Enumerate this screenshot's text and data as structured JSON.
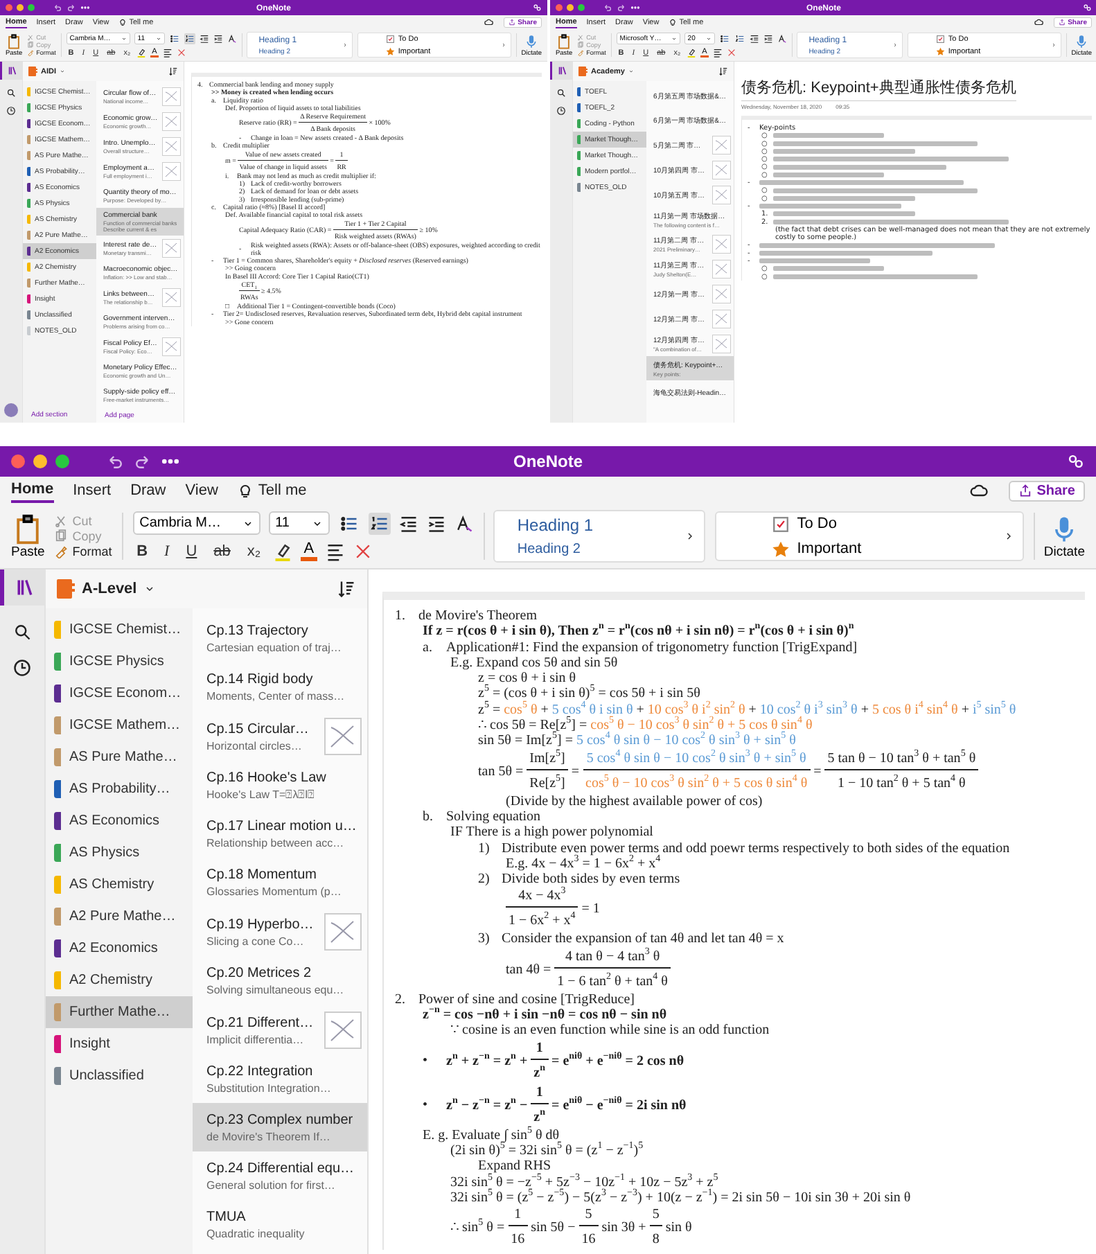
{
  "screenshots_top": [
    {
      "title": "OneNote",
      "menu_tabs": [
        {
          "label": "Home",
          "selected": true
        },
        {
          "label": "Insert",
          "selected": false
        },
        {
          "label": "Draw",
          "selected": false
        },
        {
          "label": "View",
          "selected": false
        },
        {
          "label": "Tell me",
          "selected": false
        }
      ],
      "share": "Share",
      "paste": "Paste",
      "clipboard": [
        {
          "label": "Cut",
          "disabled": true
        },
        {
          "label": "Copy",
          "disabled": true
        },
        {
          "label": "Format",
          "disabled": false
        }
      ],
      "font": "Cambria M…",
      "font_size": "11",
      "numbering_on": true,
      "format_buttons": [
        "B",
        "I",
        "U",
        "ab",
        "x₂"
      ],
      "font_color": "A",
      "styles": [
        "Heading 1",
        "Heading 2"
      ],
      "tags": [
        {
          "label": "To Do",
          "kind": "todo"
        },
        {
          "label": "Important",
          "kind": "important"
        }
      ],
      "dictate": "Dictate",
      "notebook": "AIDI",
      "sections": [
        {
          "name": "IGCSE Chemist…",
          "color": "#f5b800",
          "selected": false
        },
        {
          "name": "IGCSE Physics",
          "color": "#3aa757",
          "selected": false
        },
        {
          "name": "IGCSE Econom…",
          "color": "#5c2d91",
          "selected": false
        },
        {
          "name": "IGCSE Mathem…",
          "color": "#c19a6b",
          "selected": false
        },
        {
          "name": "AS Pure Mathe…",
          "color": "#c19a6b",
          "selected": false
        },
        {
          "name": "AS Probability…",
          "color": "#1f5fb4",
          "selected": false
        },
        {
          "name": "AS Economics",
          "color": "#5c2d91",
          "selected": false
        },
        {
          "name": "AS Physics",
          "color": "#3aa757",
          "selected": false
        },
        {
          "name": "AS Chemistry",
          "color": "#f5b800",
          "selected": false
        },
        {
          "name": "A2 Pure Mathe…",
          "color": "#c19a6b",
          "selected": false
        },
        {
          "name": "A2 Economics",
          "color": "#5c2d91",
          "selected": true
        },
        {
          "name": "A2 Chemistry",
          "color": "#f5b800",
          "selected": false
        },
        {
          "name": "Further Mathe…",
          "color": "#c19a6b",
          "selected": false
        },
        {
          "name": "Insight",
          "color": "#d6137a",
          "selected": false
        },
        {
          "name": "Unclassified",
          "color": "#7a8691",
          "selected": false
        },
        {
          "name": "NOTES_OLD",
          "color": "#c8ccd0",
          "selected": false
        }
      ],
      "pages": [
        {
          "title": "Circular flow of…",
          "preview": "National income…",
          "thumbnail": true,
          "selected": false
        },
        {
          "title": "Economic grow…",
          "preview": "Economic growth…",
          "thumbnail": true,
          "selected": false
        },
        {
          "title": "Intro. Unemplo…",
          "preview": "Overall structure…",
          "thumbnail": true,
          "selected": false
        },
        {
          "title": "Employment a…",
          "preview": "Full employment i…",
          "thumbnail": true,
          "selected": false
        },
        {
          "title": "Quantity theory of mo…",
          "preview": "Purpose: Developed by…",
          "thumbnail": false,
          "selected": false
        },
        {
          "title": "Commercial bank",
          "preview": "Function of commercial banks  Describe current & es",
          "thumbnail": false,
          "selected": true
        },
        {
          "title": "Interest rate de…",
          "preview": "Monetary transmi…",
          "thumbnail": true,
          "selected": false
        },
        {
          "title": "Macroeconomic objec…",
          "preview": "Inflation: >> Low and stab…",
          "thumbnail": false,
          "selected": false
        },
        {
          "title": "Links between…",
          "preview": "The relationship b…",
          "thumbnail": true,
          "selected": false
        },
        {
          "title": "Government interven…",
          "preview": "Problems arising from co…",
          "thumbnail": false,
          "selected": false
        },
        {
          "title": "Fiscal Policy Ef…",
          "preview": "Fiscal Policy: Eco…",
          "thumbnail": true,
          "selected": false
        },
        {
          "title": "Monetary Policy Effec…",
          "preview": "Economic growth and Un…",
          "thumbnail": false,
          "selected": false
        },
        {
          "title": "Supply-side policy eff…",
          "preview": "Free-market instruments…",
          "thumbnail": false,
          "selected": false
        }
      ],
      "add_section": "Add section",
      "add_page": "Add page",
      "note": [
        {
          "marker": "4.",
          "text": "Commercial bank lending and money supply",
          "children": [
            {
              "text": ">> Money is created when lending occurs",
              "bold": true
            },
            {
              "marker": "a.",
              "text": "Liquidity ratio",
              "children": [
                {
                  "text": "Def. Proportion of liquid assets to total liabilities",
                  "children": [
                    {
                      "parts": [
                        {
                          "t": "Reserve ratio (RR) = "
                        },
                        {
                          "num": [
                            {
                              "t": "Δ Reserve Requirement"
                            }
                          ],
                          "den": [
                            {
                              "t": "Δ Bank deposits"
                            }
                          ]
                        },
                        {
                          "t": " × 100%"
                        }
                      ]
                    },
                    {
                      "marker": "-",
                      "text": "Change in loan = New assets created - Δ Bank deposits"
                    }
                  ]
                }
              ]
            },
            {
              "marker": "b.",
              "text": "Credit multiplier",
              "children": [
                {
                  "parts": [
                    {
                      "t": "m = "
                    },
                    {
                      "num": [
                        {
                          "t": "Value of new assets created"
                        }
                      ],
                      "den": [
                        {
                          "t": "Value of change in liquid assets"
                        }
                      ]
                    },
                    {
                      "t": " = "
                    },
                    {
                      "num": [
                        {
                          "t": "1"
                        }
                      ],
                      "den": [
                        {
                          "t": "RR"
                        }
                      ]
                    }
                  ]
                },
                {
                  "marker": "i.",
                  "text": "Bank may not lend as much as credit multiplier if:",
                  "children": [
                    {
                      "marker": "1)",
                      "text": "Lack of credit-worthy borrowers"
                    },
                    {
                      "marker": "2)",
                      "text": "Lack of demand for loan or debt assets"
                    },
                    {
                      "marker": "3)",
                      "text": "Irresponsible lending (sub-prime)"
                    }
                  ]
                }
              ]
            },
            {
              "marker": "c.",
              "text": "Capital ratio (≈8%) [Basel II accord]",
              "children": [
                {
                  "text": "Def. Available financial capital to total risk assets",
                  "children": [
                    {
                      "parts": [
                        {
                          "t": "Capital Adequacy Ratio (CAR) = "
                        },
                        {
                          "num": [
                            {
                              "t": "Tier 1 + Tier 2 Capital"
                            }
                          ],
                          "den": [
                            {
                              "t": "Risk weighted assets (RWAs)"
                            }
                          ]
                        },
                        {
                          "t": " ≥ 10%"
                        }
                      ]
                    },
                    {
                      "marker": "-",
                      "text": "Risk weighted assets (RWA): Assets or off-balance-sheet (OBS) exposures, weighted according to credit risk"
                    }
                  ]
                }
              ]
            },
            {
              "marker": "-",
              "text": "Tier 1 = Common shares, Shareholder's equity + *Disclosed reserves* (Reserved earnings)",
              "children": [
                {
                  "text": ">> Going concern"
                },
                {
                  "text": "In Basel III Accord: Core Tier 1 Capital Ratio(CT1)",
                  "children": [
                    {
                      "parts": [
                        {
                          "num": [
                            {
                              "t": "CET$_{1}$"
                            }
                          ],
                          "den": [
                            {
                              "t": "RWAs"
                            }
                          ]
                        },
                        {
                          "t": " ≥ 4.5%"
                        }
                      ]
                    }
                  ]
                },
                {
                  "marker": "□",
                  "text": "Additional Tier 1 = Contingent-convertible bonds (Coco)"
                }
              ]
            },
            {
              "marker": "-",
              "text": "Tier 2= Undisclosed reserves, Revaluation reserves, Subordinated term debt, Hybrid debt capital instrument",
              "children": [
                {
                  "text": ">> Gone concern"
                }
              ]
            }
          ]
        }
      ]
    },
    {
      "title": "OneNote",
      "menu_tabs": [
        {
          "label": "Home",
          "selected": true
        },
        {
          "label": "Insert",
          "selected": false
        },
        {
          "label": "Draw",
          "selected": false
        },
        {
          "label": "View",
          "selected": false
        },
        {
          "label": "Tell me",
          "selected": false
        }
      ],
      "share": "Share",
      "paste": "Paste",
      "clipboard": [
        {
          "label": "Cut",
          "disabled": true
        },
        {
          "label": "Copy",
          "disabled": true
        },
        {
          "label": "Format",
          "disabled": false
        }
      ],
      "font": "Microsoft Y…",
      "font_size": "20",
      "numbering_on": false,
      "format_buttons": [
        "B",
        "I",
        "U",
        "ab",
        "x₂"
      ],
      "font_color": "A",
      "styles": [
        "Heading 1",
        "Heading 2"
      ],
      "tags": [
        {
          "label": "To Do",
          "kind": "todo"
        },
        {
          "label": "Important",
          "kind": "important"
        }
      ],
      "dictate": "Dictate",
      "notebook": "Academy",
      "sections": [
        {
          "name": "TOEFL",
          "color": "#1f5fb4",
          "selected": false
        },
        {
          "name": "TOEFL_2",
          "color": "#1f5fb4",
          "selected": false
        },
        {
          "name": "Coding - Python",
          "color": "#3aa757",
          "selected": false
        },
        {
          "name": "Market Though…",
          "color": "#3aa757",
          "selected": true
        },
        {
          "name": "Market Though…",
          "color": "#3aa757",
          "selected": false
        },
        {
          "name": "Modern portfol…",
          "color": "#3aa757",
          "selected": false
        },
        {
          "name": "NOTES_OLD",
          "color": "#7a8691",
          "selected": false
        }
      ],
      "pages": [
        {
          "title": "6月第五周 市场数据&…",
          "thumbnail": false,
          "selected": false
        },
        {
          "title": "6月第一周 市场数据&…",
          "thumbnail": false,
          "selected": false
        },
        {
          "title": "5月第二周 市…",
          "thumbnail": true,
          "selected": false
        },
        {
          "title": "10月第四周 市…",
          "thumbnail": true,
          "selected": false
        },
        {
          "title": "10月第五周 市…",
          "thumbnail": true,
          "selected": false
        },
        {
          "title": "11月第一周 市场数据…",
          "preview": "The following content is f…",
          "thumbnail": false,
          "selected": false
        },
        {
          "title": "11月第二周 市…",
          "preview": "2021 Preliminary…",
          "thumbnail": true,
          "selected": false
        },
        {
          "title": "11月第三周 市…",
          "preview": "Judy Shelton(E…",
          "thumbnail": true,
          "selected": false
        },
        {
          "title": "12月第一周 市…",
          "thumbnail": true,
          "selected": false
        },
        {
          "title": "12月第二周 市…",
          "thumbnail": true,
          "selected": false
        },
        {
          "title": "12月第四周 市…",
          "preview": "\"A combination of…",
          "thumbnail": true,
          "selected": false
        },
        {
          "title": "债务危机: Keypoint+…",
          "preview": "Key points:",
          "thumbnail": false,
          "selected": true
        },
        {
          "title": "海龟交易法则-Headin…",
          "thumbnail": false,
          "selected": false
        }
      ],
      "page_heading": "债务危机: Keypoint+典型通胀性债务危机",
      "page_date": "Wednesday, November 18, 2020",
      "page_time": "09:35",
      "note": [
        {
          "marker": "-",
          "text": "Key-points",
          "children": [
            {
              "marker": "○",
              "kind": "blurred"
            },
            {
              "marker": "○",
              "kind": "blurred"
            },
            {
              "marker": "○",
              "kind": "blurred"
            },
            {
              "marker": "○",
              "kind": "blurred"
            },
            {
              "marker": "○",
              "kind": "blurred"
            },
            {
              "marker": "○",
              "kind": "blurred"
            }
          ]
        },
        {
          "marker": "-",
          "kind": "blurred",
          "children": [
            {
              "marker": "○",
              "kind": "blurred"
            },
            {
              "marker": "○",
              "kind": "blurred"
            }
          ]
        },
        {
          "marker": "-",
          "kind": "blurred",
          "children": [
            {
              "marker": "1.",
              "kind": "blurred"
            },
            {
              "marker": "2.",
              "kind": "blurred",
              "children": [
                {
                  "text": "(the fact that debt crises can be well-managed does not mean that they are not extremely costly to some people.)"
                }
              ]
            }
          ]
        },
        {
          "marker": "-",
          "kind": "blurred"
        },
        {
          "marker": "-",
          "kind": "blurred"
        },
        {
          "marker": "-",
          "kind": "blurred",
          "children": [
            {
              "marker": "○",
              "kind": "blurred"
            },
            {
              "marker": "○",
              "kind": "blurred"
            }
          ]
        }
      ]
    }
  ],
  "main_window": {
    "title": "OneNote",
    "menu_tabs": [
      {
        "label": "Home",
        "selected": true
      },
      {
        "label": "Insert",
        "selected": false
      },
      {
        "label": "Draw",
        "selected": false
      },
      {
        "label": "View",
        "selected": false
      },
      {
        "label": "Tell me",
        "selected": false
      }
    ],
    "share": "Share",
    "paste": "Paste",
    "clipboard": [
      {
        "label": "Cut",
        "disabled": true
      },
      {
        "label": "Copy",
        "disabled": true
      },
      {
        "label": "Format",
        "disabled": false
      }
    ],
    "font": "Cambria M…",
    "font_size": "11",
    "numbering_on": true,
    "format_buttons": [
      "B",
      "I",
      "U",
      "ab",
      "x₂"
    ],
    "font_color": "A",
    "styles": [
      "Heading 1",
      "Heading 2"
    ],
    "tags": [
      {
        "label": "To Do",
        "kind": "todo"
      },
      {
        "label": "Important",
        "kind": "important"
      }
    ],
    "dictate": "Dictate",
    "notebook": "A-Level",
    "sections": [
      {
        "name": "IGCSE Chemist…",
        "color": "#f5b800",
        "selected": false
      },
      {
        "name": "IGCSE Physics",
        "color": "#3aa757",
        "selected": false
      },
      {
        "name": "IGCSE Econom…",
        "color": "#5c2d91",
        "selected": false
      },
      {
        "name": "IGCSE Mathem…",
        "color": "#c19a6b",
        "selected": false
      },
      {
        "name": "AS Pure Mathe…",
        "color": "#c19a6b",
        "selected": false
      },
      {
        "name": "AS Probability…",
        "color": "#1f5fb4",
        "selected": false
      },
      {
        "name": "AS Economics",
        "color": "#5c2d91",
        "selected": false
      },
      {
        "name": "AS Physics",
        "color": "#3aa757",
        "selected": false
      },
      {
        "name": "AS Chemistry",
        "color": "#f5b800",
        "selected": false
      },
      {
        "name": "A2 Pure Mathe…",
        "color": "#c19a6b",
        "selected": false
      },
      {
        "name": "A2 Economics",
        "color": "#5c2d91",
        "selected": false
      },
      {
        "name": "A2 Chemistry",
        "color": "#f5b800",
        "selected": false
      },
      {
        "name": "Further Mathe…",
        "color": "#c19a6b",
        "selected": true
      },
      {
        "name": "Insight",
        "color": "#d6137a",
        "selected": false
      },
      {
        "name": "Unclassified",
        "color": "#7a8691",
        "selected": false
      }
    ],
    "pages": [
      {
        "title": "Cp.13 Trajectory",
        "preview": "Cartesian equation of traj…",
        "thumbnail": false,
        "selected": false
      },
      {
        "title": "Cp.14 Rigid body",
        "preview": "Moments, Center of mass…",
        "thumbnail": false,
        "selected": false
      },
      {
        "title": "Cp.15 Circular…",
        "preview": "Horizontal circles…",
        "thumbnail": true,
        "selected": false
      },
      {
        "title": "Cp.16 Hooke's Law",
        "preview": "Hooke's Law  T=⍰λ⍰l⍰",
        "thumbnail": false,
        "selected": false
      },
      {
        "title": "Cp.17 Linear motion u…",
        "preview": "Relationship between acc…",
        "thumbnail": false,
        "selected": false
      },
      {
        "title": "Cp.18 Momentum",
        "preview": "Glossaries  Momentum (p…",
        "thumbnail": false,
        "selected": false
      },
      {
        "title": "Cp.19 Hyperbo…",
        "preview": "Slicing a cone  Co…",
        "thumbnail": true,
        "selected": false
      },
      {
        "title": "Cp.20 Metrices 2",
        "preview": "Solving simultaneous equ…",
        "thumbnail": false,
        "selected": false
      },
      {
        "title": "Cp.21 Different…",
        "preview": "Implicit differentia…",
        "thumbnail": true,
        "selected": false
      },
      {
        "title": "Cp.22 Integration",
        "preview": "Substitution  Integration…",
        "thumbnail": false,
        "selected": false
      },
      {
        "title": "Cp.23 Complex number",
        "preview": "de Movire's Theorem  If…",
        "thumbnail": false,
        "selected": true
      },
      {
        "title": "Cp.24 Differential equ…",
        "preview": "General solution for first…",
        "thumbnail": false,
        "selected": false
      },
      {
        "title": "TMUA",
        "preview": "Quadratic inequality",
        "thumbnail": false,
        "selected": false
      }
    ],
    "note": [
      {
        "marker": "1.",
        "text": "de Movire's Theorem",
        "children": [
          {
            "bold": true,
            "parts": [
              {
                "t": "If z = r(cos θ + i sin θ), Then z$^{n}$ = r$^{n}$(cos nθ + i sin nθ) = r$^{n}$(cos θ + i sin θ)$^{n}$"
              }
            ]
          },
          {
            "marker": "a.",
            "text": "Application#1: Find the expansion of trigonometry function [TrigExpand]",
            "children": [
              {
                "text": "E.g. Expand cos 5θ and sin 5θ",
                "children": [
                  {
                    "parts": [
                      {
                        "t": "z = cos θ + i sin θ"
                      }
                    ]
                  },
                  {
                    "parts": [
                      {
                        "t": "z$^{5}$ = (cos θ + i sin θ)$^{5}$ = cos 5θ + i sin 5θ"
                      }
                    ]
                  },
                  {
                    "parts": [
                      {
                        "t": "z$^{5}$ = "
                      },
                      {
                        "t": "cos$^{5}$ θ",
                        "color": "#ee8a3c"
                      },
                      {
                        "t": " + "
                      },
                      {
                        "t": "5 cos$^{4}$ θ i sin θ",
                        "color": "#5b9bd5"
                      },
                      {
                        "t": " + "
                      },
                      {
                        "t": "10 cos$^{3}$ θ i$^{2}$ sin$^{2}$ θ",
                        "color": "#ee8a3c"
                      },
                      {
                        "t": " + "
                      },
                      {
                        "t": "10 cos$^{2}$ θ i$^{3}$ sin$^{3}$ θ",
                        "color": "#5b9bd5"
                      },
                      {
                        "t": " + "
                      },
                      {
                        "t": "5 cos θ i$^{4}$ sin$^{4}$ θ",
                        "color": "#ee8a3c"
                      },
                      {
                        "t": " + "
                      },
                      {
                        "t": "i$^{5}$ sin$^{5}$ θ",
                        "color": "#5b9bd5"
                      }
                    ]
                  },
                  {
                    "parts": [
                      {
                        "t": "∴ cos 5θ = Re[z$^{5}$] = "
                      },
                      {
                        "t": "cos$^{5}$ θ − 10 cos$^{3}$ θ sin$^{2}$ θ + 5 cos θ sin$^{4}$ θ",
                        "color": "#ee8a3c"
                      }
                    ]
                  },
                  {
                    "parts": [
                      {
                        "t": "sin 5θ = Im[z$^{5}$] = "
                      },
                      {
                        "t": "5 cos$^{4}$ θ sin θ − 10 cos$^{2}$ θ sin$^{3}$ θ + sin$^{5}$ θ",
                        "color": "#5b9bd5"
                      }
                    ]
                  },
                  {
                    "parts": [
                      {
                        "t": "tan 5θ = "
                      },
                      {
                        "num": [
                          {
                            "t": "Im[z$^{5}$]"
                          }
                        ],
                        "den": [
                          {
                            "t": "Re[z$^{5}$]"
                          }
                        ]
                      },
                      {
                        "t": " = "
                      },
                      {
                        "num": [
                          {
                            "t": "5 cos$^{4}$ θ sin θ − 10 cos$^{2}$ θ sin$^{3}$ θ + sin$^{5}$ θ",
                            "color": "#5b9bd5"
                          }
                        ],
                        "den": [
                          {
                            "t": "cos$^{5}$ θ − 10 cos$^{3}$ θ sin$^{2}$ θ + 5 cos θ sin$^{4}$ θ",
                            "color": "#ee8a3c"
                          }
                        ]
                      },
                      {
                        "t": " = "
                      },
                      {
                        "num": [
                          {
                            "t": "5 tan θ − 10 tan$^{3}$ θ + tan$^{5}$ θ"
                          }
                        ],
                        "den": [
                          {
                            "t": "1 − 10 tan$^{2}$ θ + 5 tan$^{4}$ θ"
                          }
                        ]
                      }
                    ],
                    "children": [
                      {
                        "text": "(Divide by the highest available power of cos)"
                      }
                    ]
                  }
                ]
              }
            ]
          },
          {
            "marker": "b.",
            "text": "Solving equation",
            "children": [
              {
                "text": "IF There is a high power polynomial",
                "children": [
                  {
                    "marker": "1)",
                    "text": "Distribute even power terms and odd poewr terms respectively to both sides of the equation",
                    "children": [
                      {
                        "parts": [
                          {
                            "t": "E.g. 4x − 4x$^{3}$ = 1 − 6x$^{2}$ + x$^{4}$"
                          }
                        ]
                      }
                    ]
                  },
                  {
                    "marker": "2)",
                    "text": "Divide both sides by even terms",
                    "children": [
                      {
                        "parts": [
                          {
                            "num": [
                              {
                                "t": "4x − 4x$^{3}$"
                              }
                            ],
                            "den": [
                              {
                                "t": "1 − 6x$^{2}$ + x$^{4}$"
                              }
                            ]
                          },
                          {
                            "t": " = 1"
                          }
                        ]
                      }
                    ]
                  },
                  {
                    "marker": "3)",
                    "text": "Consider the expansion of tan 4θ and let tan 4θ = x",
                    "children": [
                      {
                        "parts": [
                          {
                            "t": "tan 4θ = "
                          },
                          {
                            "num": [
                              {
                                "t": "4 tan θ − 4 tan$^{3}$ θ"
                              }
                            ],
                            "den": [
                              {
                                "t": "1 − 6 tan$^{2}$ θ + tan$^{4}$ θ"
                              }
                            ]
                          }
                        ]
                      }
                    ]
                  }
                ]
              }
            ]
          }
        ]
      },
      {
        "marker": "2.",
        "text": "Power of sine and cosine [TrigReduce]",
        "children": [
          {
            "bold": true,
            "parts": [
              {
                "t": "z$^{−n}$ = cos −nθ + i sin −nθ = cos nθ − sin nθ"
              }
            ],
            "children": [
              {
                "text": "∵ cosine is an even function while sine is an odd function"
              }
            ]
          },
          {
            "marker": "•",
            "bold": true,
            "parts": [
              {
                "t": "z$^{n}$ + z$^{−n}$ = z$^{n}$ + "
              },
              {
                "num": [
                  {
                    "t": "1"
                  }
                ],
                "den": [
                  {
                    "t": "z$^{n}$"
                  }
                ]
              },
              {
                "t": " = e$^{niθ}$ + e$^{−niθ}$ = 2 cos nθ"
              }
            ]
          },
          {
            "marker": "•",
            "bold": true,
            "parts": [
              {
                "t": "z$^{n}$ − z$^{−n}$ = z$^{n}$ − "
              },
              {
                "num": [
                  {
                    "t": "1"
                  }
                ],
                "den": [
                  {
                    "t": "z$^{n}$"
                  }
                ]
              },
              {
                "t": " = e$^{niθ}$ − e$^{−niθ}$ = 2i sin nθ"
              }
            ]
          },
          {
            "parts": [
              {
                "t": "E. g. Evaluate ∫ sin$^{5}$ θ dθ"
              }
            ],
            "children": [
              {
                "parts": [
                  {
                    "t": "(2i sin θ)$^{5}$ = 32i sin$^{5}$ θ = (z$^{1}$ − z$^{−1}$)$^{5}$"
                  }
                ],
                "children": [
                  {
                    "text": "Expand RHS"
                  }
                ]
              },
              {
                "parts": [
                  {
                    "t": "32i sin$^{5}$ θ = −z$^{−5}$ + 5z$^{−3}$ − 10z$^{−1}$ + 10z − 5z$^{3}$ + z$^{5}$"
                  }
                ]
              },
              {
                "parts": [
                  {
                    "t": "32i sin$^{5}$ θ = (z$^{5}$ − z$^{−5}$) − 5(z$^{3}$ − z$^{−3}$) + 10(z − z$^{−1}$) = 2i sin 5θ − 10i sin 3θ + 20i sin θ"
                  }
                ]
              },
              {
                "parts": [
                  {
                    "t": "∴ sin$^{5}$ θ = "
                  },
                  {
                    "num": [
                      {
                        "t": "1"
                      }
                    ],
                    "den": [
                      {
                        "t": "16"
                      }
                    ]
                  },
                  {
                    "t": " sin 5θ − "
                  },
                  {
                    "num": [
                      {
                        "t": "5"
                      }
                    ],
                    "den": [
                      {
                        "t": "16"
                      }
                    ]
                  },
                  {
                    "t": " sin 3θ + "
                  },
                  {
                    "num": [
                      {
                        "t": "5"
                      }
                    ],
                    "den": [
                      {
                        "t": "8"
                      }
                    ]
                  },
                  {
                    "t": " sin θ"
                  }
                ]
              }
            ]
          }
        ]
      }
    ]
  }
}
